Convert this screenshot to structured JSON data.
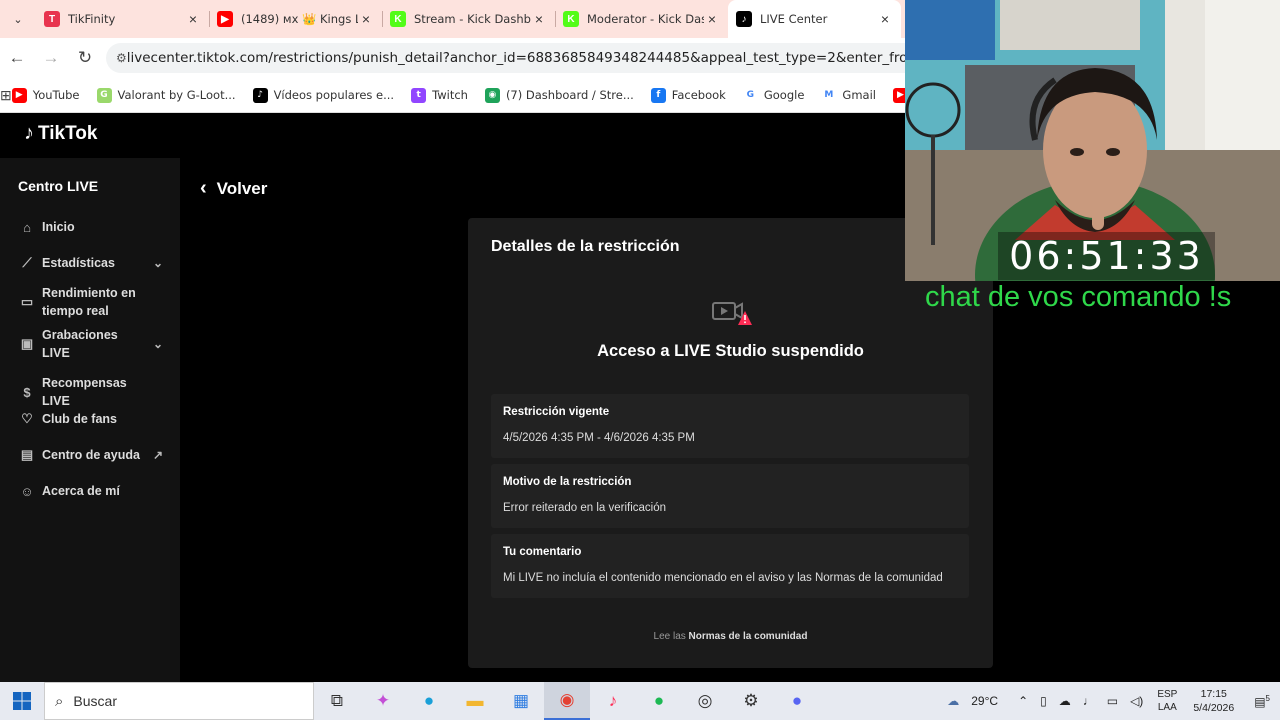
{
  "browser": {
    "tabs": [
      {
        "title": "TikFinity",
        "favicon_color": "#e8344e",
        "favicon_glyph": "T",
        "icon": "tikfinity-icon",
        "active": false
      },
      {
        "title": "(1489) мх 👑 Kings L",
        "favicon_color": "#ff0000",
        "favicon_glyph": "▶",
        "icon": "youtube-icon",
        "active": false
      },
      {
        "title": "Stream - Kick Dashbo",
        "favicon_color": "#53fc18",
        "favicon_glyph": "K",
        "icon": "kick-icon",
        "active": false
      },
      {
        "title": "Moderator - Kick Das",
        "favicon_color": "#53fc18",
        "favicon_glyph": "K",
        "icon": "kick-icon",
        "active": false
      },
      {
        "title": "LIVE Center",
        "favicon_color": "#000000",
        "favicon_glyph": "♪",
        "icon": "tiktok-icon",
        "active": true
      }
    ],
    "url": "livecenter.tiktok.com/restrictions/punish_detail?anchor_id=6883685849348244485&appeal_test_type=2&enter_from=penalty_inbox",
    "bookmarks": [
      {
        "label": "YouTube",
        "color": "#ff0000",
        "glyph": "▶",
        "icon": "youtube-icon"
      },
      {
        "label": "Valorant by G-Loot...",
        "color": "#9ad86b",
        "glyph": "G",
        "icon": "gloot-icon"
      },
      {
        "label": "Vídeos populares e...",
        "color": "#000000",
        "glyph": "♪",
        "icon": "tiktok-icon"
      },
      {
        "label": "Twitch",
        "color": "#9146ff",
        "glyph": "t",
        "icon": "twitch-icon"
      },
      {
        "label": "(7) Dashboard / Stre...",
        "color": "#1fa35a",
        "glyph": "◉",
        "icon": "streamlabs-icon"
      },
      {
        "label": "Facebook",
        "color": "#1877f2",
        "glyph": "f",
        "icon": "facebook-icon"
      },
      {
        "label": "Google",
        "color": "#ffffff",
        "glyph": "G",
        "icon": "google-icon"
      },
      {
        "label": "Gmail",
        "color": "#ffffff",
        "glyph": "M",
        "icon": "gmail-icon"
      },
      {
        "label": "YouTu",
        "color": "#ff0000",
        "glyph": "▶",
        "icon": "youtube-icon"
      }
    ]
  },
  "tiktok": {
    "logo": "TikTok",
    "sidebar": {
      "title": "Centro LIVE",
      "items": [
        {
          "label": "Inicio",
          "icon": "home-icon",
          "glyph": "⌂"
        },
        {
          "label": "Estadísticas",
          "icon": "chart-icon",
          "glyph": "⟋"
        },
        {
          "label": "Rendimiento en tiempo real",
          "icon": "monitor-icon",
          "glyph": "▭"
        },
        {
          "label": "Grabaciones LIVE",
          "icon": "recording-icon",
          "glyph": "▣"
        },
        {
          "label": "Recompensas LIVE",
          "icon": "coin-icon",
          "glyph": "$"
        },
        {
          "label": "Club de fans",
          "icon": "heart-icon",
          "glyph": "♡"
        },
        {
          "label": "Centro de ayuda",
          "icon": "help-icon",
          "glyph": "▤"
        },
        {
          "label": "Acerca de mí",
          "icon": "person-icon",
          "glyph": "☺"
        }
      ]
    },
    "back_label": "Volver",
    "card": {
      "title": "Detalles de la restricción",
      "heading": "Acceso a LIVE Studio suspendido",
      "details": [
        {
          "label": "Restricción vigente",
          "value": "4/5/2026 4:35 PM - 4/6/2026 4:35 PM"
        },
        {
          "label": "Motivo de la restricción",
          "value": "Error reiterado en la verificación"
        },
        {
          "label": "Tu comentario",
          "value": "Mi LIVE no incluía el contenido mencionado en el aviso y las Normas de la comunidad"
        }
      ],
      "footer_prefix": "Lee las",
      "footer_link": "Normas de la comunidad"
    }
  },
  "overlay": {
    "timer": "06:51:33",
    "chat_text": "chat de vos comando !s"
  },
  "taskbar": {
    "search_placeholder": "Buscar",
    "weather": "29°C",
    "lang_top": "ESP",
    "lang_bottom": "LAA",
    "time": "17:15",
    "date": "5/4/2026",
    "notification_count": "5"
  }
}
